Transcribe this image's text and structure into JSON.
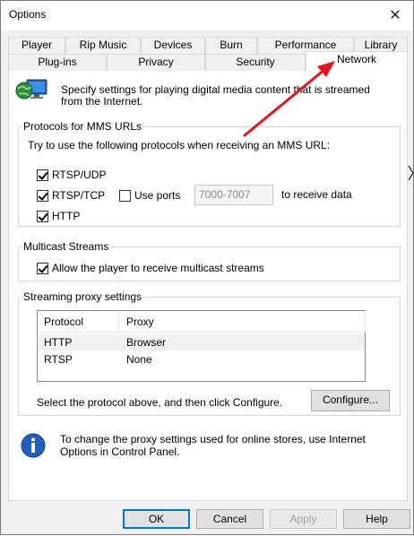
{
  "window": {
    "title": "Options",
    "close_glyph": "✕"
  },
  "tabs_row1": [
    "Player",
    "Rip Music",
    "Devices",
    "Burn",
    "Performance",
    "Library"
  ],
  "tabs_row2": [
    "Plug-ins",
    "Privacy",
    "Security",
    "Network"
  ],
  "active_tab": "Network",
  "intro": {
    "line1": "Specify settings for playing digital media content that is streamed",
    "line2": "from the Internet.",
    "icon": "network-globe-icon"
  },
  "protocols": {
    "legend": "Protocols for MMS URLs",
    "instruction": "Try to use the following protocols when receiving an MMS URL:",
    "rtsp_udp": {
      "label": "RTSP/UDP",
      "checked": true
    },
    "rtsp_tcp": {
      "label": "RTSP/TCP",
      "checked": true
    },
    "use_ports": {
      "label": "Use ports",
      "checked": false
    },
    "ports_value": "7000-7007",
    "ports_suffix": "to receive data",
    "http": {
      "label": "HTTP",
      "checked": true
    }
  },
  "multicast": {
    "legend": "Multicast Streams",
    "allow": {
      "label": "Allow the player to receive multicast streams",
      "checked": true
    }
  },
  "proxy": {
    "legend": "Streaming proxy settings",
    "columns": [
      "Protocol",
      "Proxy"
    ],
    "rows": [
      {
        "protocol": "HTTP",
        "proxy": "Browser"
      },
      {
        "protocol": "RTSP",
        "proxy": "None"
      }
    ],
    "hint": "Select the protocol above, and then click Configure.",
    "configure_label": "Configure..."
  },
  "info": {
    "line1": "To change the proxy settings used for online stores, use Internet",
    "line2": "Options in Control Panel.",
    "icon": "info-icon"
  },
  "buttons": {
    "ok": "OK",
    "cancel": "Cancel",
    "apply": "Apply",
    "help": "Help"
  },
  "colors": {
    "annotation_arrow": "#e8141b",
    "accent": "#0078d7",
    "info_blue": "#1f5fbf"
  }
}
